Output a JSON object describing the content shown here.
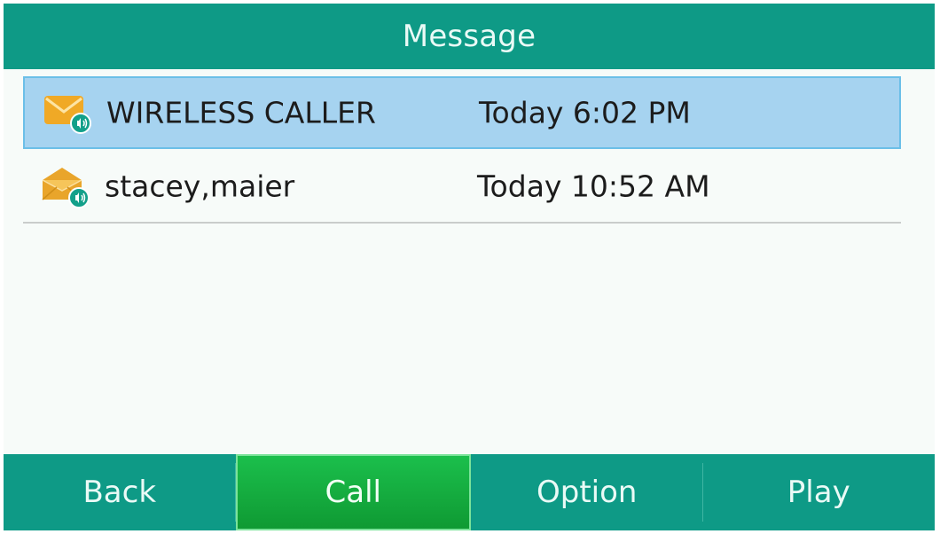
{
  "header": {
    "title": "Message"
  },
  "messages": [
    {
      "name": "WIRELESS CALLER",
      "time": "Today 6:02 PM",
      "icon": "voicemail-envelope-closed-icon",
      "selected": true
    },
    {
      "name": "stacey,maier",
      "time": "Today 10:52 AM",
      "icon": "voicemail-envelope-open-icon",
      "selected": false
    }
  ],
  "softkeys": [
    {
      "label": "Back"
    },
    {
      "label": "Call",
      "active": true
    },
    {
      "label": "Option"
    },
    {
      "label": "Play"
    }
  ],
  "colors": {
    "header_bg": "#0e9a86",
    "selected_row": "#a6d3f0",
    "active_key": "#17b343",
    "envelope": "#f2b23a"
  }
}
